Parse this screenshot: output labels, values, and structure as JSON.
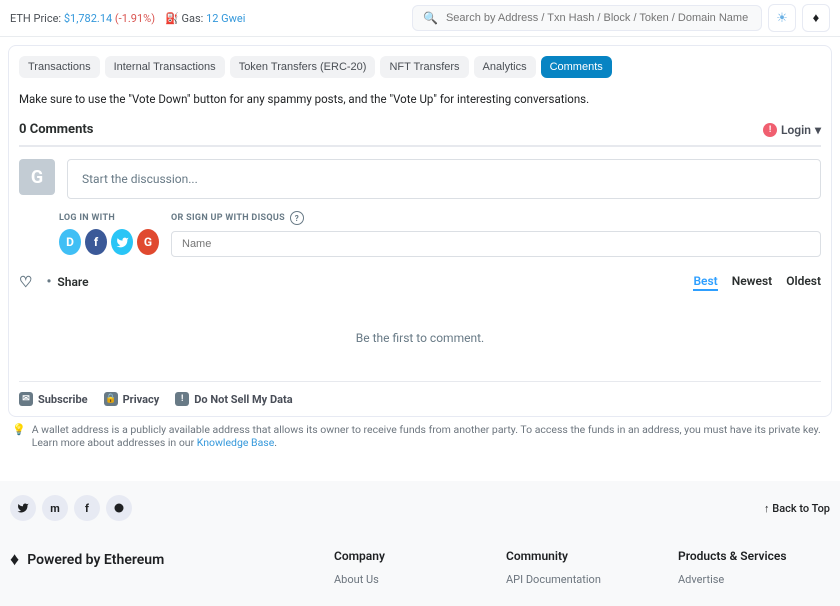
{
  "header": {
    "eth_label": "ETH Price:",
    "eth_price": "$1,782.14",
    "eth_change": "(-1.91%)",
    "gas_label": "Gas:",
    "gas_value": "12 Gwei",
    "search_placeholder": "Search by Address / Txn Hash / Block / Token / Domain Name"
  },
  "tabs": [
    "Transactions",
    "Internal Transactions",
    "Token Transfers (ERC-20)",
    "NFT Transfers",
    "Analytics",
    "Comments"
  ],
  "msg": "Make sure to use the \"Vote Down\" button for any spammy posts, and the \"Vote Up\" for interesting conversations.",
  "comments": {
    "count": "0 Comments",
    "login": "Login",
    "avatar": "G",
    "placeholder": "Start the discussion...",
    "login_with": "LOG IN WITH",
    "signup": "OR SIGN UP WITH DISQUS",
    "name_ph": "Name",
    "share": "Share",
    "sort": {
      "best": "Best",
      "newest": "Newest",
      "oldest": "Oldest"
    },
    "empty": "Be the first to comment.",
    "sub": "Subscribe",
    "priv": "Privacy",
    "dns": "Do Not Sell My Data"
  },
  "note": {
    "text": "A wallet address is a publicly available address that allows its owner to receive funds from another party. To access the funds in an address, you must have its private key. Learn more about addresses in our ",
    "kb": "Knowledge Base"
  },
  "footer": {
    "back": "Back to Top",
    "powered": "Powered by Ethereum",
    "cols": {
      "company": {
        "h": "Company",
        "l": [
          "About Us"
        ]
      },
      "community": {
        "h": "Community",
        "l": [
          "API Documentation"
        ]
      },
      "products": {
        "h": "Products & Services",
        "l": [
          "Advertise"
        ]
      }
    }
  }
}
